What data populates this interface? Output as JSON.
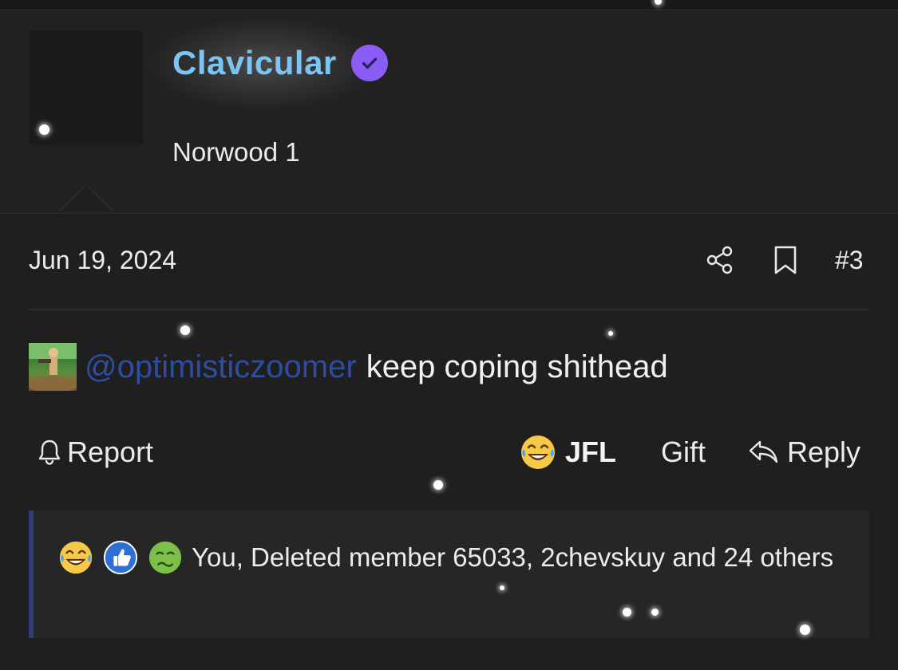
{
  "user": {
    "name": "Clavicular",
    "title": "Norwood 1"
  },
  "post": {
    "date": "Jun 19, 2024",
    "number": "#3",
    "mention": "@optimisticzoomer",
    "text": "keep coping shithead"
  },
  "actions": {
    "report_label": "Report",
    "reaction_label": "JFL",
    "gift_label": "Gift",
    "reply_label": "Reply"
  },
  "reactions": {
    "summary": "You, Deleted member 65033, 2chevskuy and 24 others",
    "icons": [
      "crying-laughing-emoji",
      "thumbs-up-emoji",
      "nauseated-emoji"
    ]
  },
  "colors": {
    "background": "#1f1f1f",
    "username": "#7cc4f2",
    "verified": "#8b5cf6",
    "mention": "#2f4da0",
    "reactions_accent": "#2e3f77"
  }
}
